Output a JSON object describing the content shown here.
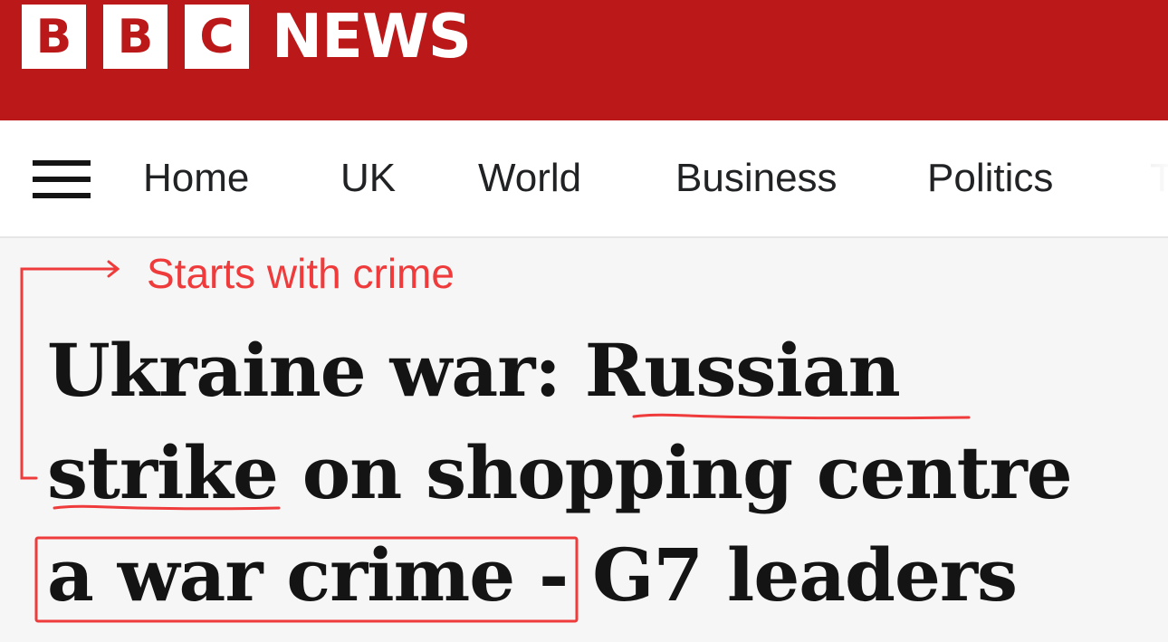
{
  "header": {
    "brand_letters": [
      "B",
      "B",
      "C"
    ],
    "brand_word": "NEWS",
    "brand_color": "#bb1919"
  },
  "nav": {
    "menu_icon": "hamburger-menu-icon",
    "items": [
      "Home",
      "UK",
      "World",
      "Business",
      "Politics"
    ]
  },
  "annotation": {
    "label": "Starts with crime",
    "color": "#ef3b3b"
  },
  "headline": {
    "lines": [
      "Ukraine war: Russian",
      "strike on shopping centre",
      "a war crime - G7 leaders"
    ]
  }
}
